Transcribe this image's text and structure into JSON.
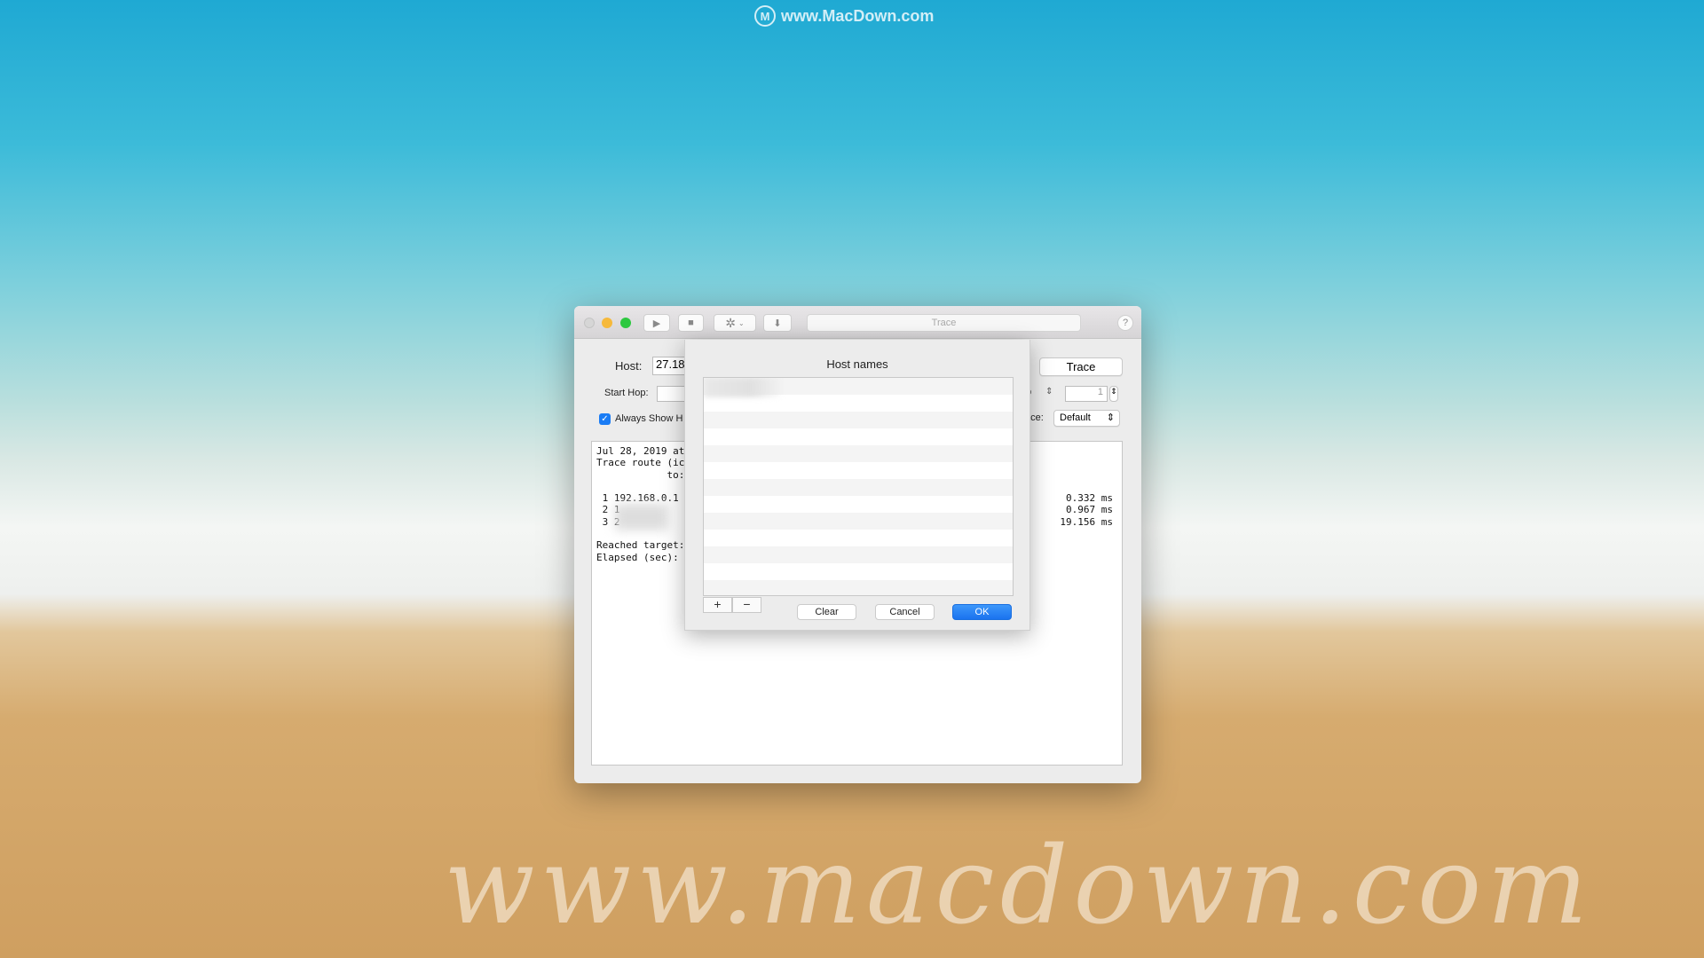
{
  "watermark": {
    "top": "www.MacDown.com",
    "sand": "www.macdown.com"
  },
  "colors": {
    "accent": "#1a7cf5",
    "close": "#d6d6d6",
    "minimize": "#f6b93b",
    "zoom": "#2dc840"
  },
  "toolbar": {
    "title": "Trace",
    "help": "?",
    "play_icon": "play-icon",
    "stop_icon": "stop-icon",
    "gear_icon": "gear-icon",
    "download_icon": "download-icon"
  },
  "form": {
    "host_label": "Host:",
    "host_value": "27.18",
    "start_hop_label": "Start Hop:",
    "start_hop_value": "",
    "always_show_label": "Always Show H",
    "always_show_checked": true,
    "trace_button": "Trace",
    "right_label_partial": "p",
    "max_hop_value": "1",
    "interface_label": "ace:",
    "interface_value": "Default"
  },
  "output": {
    "lines": [
      "Jul 28, 2019 at",
      "Trace route (ic",
      "            to:",
      "",
      " 1 192.168.0.1",
      " 2 1",
      " 3 2",
      "",
      "Reached target:",
      "Elapsed (sec):"
    ],
    "times": [
      "0.332 ms",
      "0.967 ms",
      "19.156 ms"
    ]
  },
  "sheet": {
    "title": "Host names",
    "add": "+",
    "remove": "−",
    "clear": "Clear",
    "cancel": "Cancel",
    "ok": "OK"
  }
}
